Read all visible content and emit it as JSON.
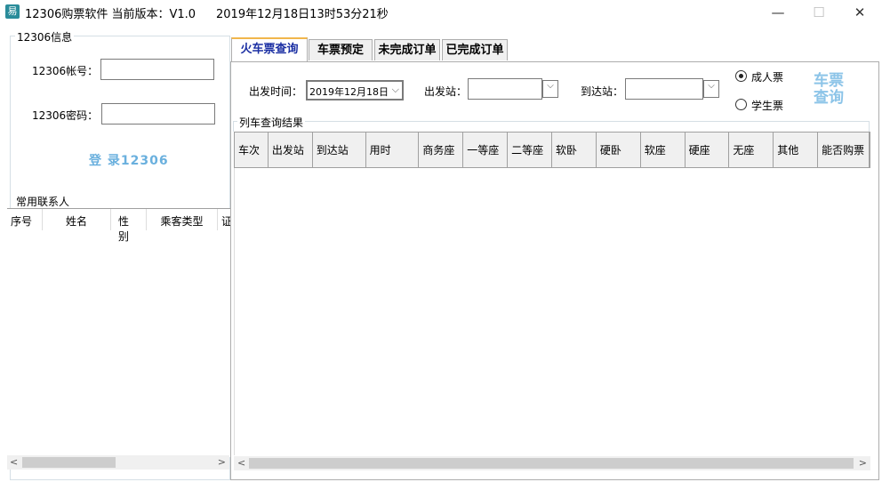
{
  "window": {
    "title": "12306购票软件 当前版本：V1.0",
    "datetime": "2019年12月18日13时53分21秒",
    "minimize": "—",
    "maximize": "☐",
    "close": "✕"
  },
  "login": {
    "group": "12306信息",
    "account_label": "12306帐号：",
    "account_value": "",
    "password_label": "12306密码：",
    "password_value": "",
    "login_button": "登 录12306"
  },
  "contacts": {
    "title": "常用联系人",
    "columns": [
      "序号",
      "姓名",
      "性别",
      "乘客类型",
      "证"
    ]
  },
  "tabs": [
    {
      "label": "火车票查询",
      "active": true
    },
    {
      "label": "车票预定"
    },
    {
      "label": "未完成订单"
    },
    {
      "label": "已完成订单"
    }
  ],
  "query": {
    "date_label": "出发时间：",
    "date_value": "2019年12月18日",
    "from_label": "出发站：",
    "from_value": "",
    "to_label": "到达站：",
    "to_value": "",
    "adult": "成人票",
    "student": "学生票",
    "ticket_type": "adult",
    "query_button": [
      "车票",
      "查询"
    ]
  },
  "results": {
    "title": "列车查询结果",
    "columns": [
      "车次",
      "出发站",
      "到达站",
      "用时",
      "商务座",
      "一等座",
      "二等座",
      "软卧",
      "硬卧",
      "软座",
      "硬座",
      "无座",
      "其他",
      "能否购票"
    ]
  },
  "colors": {
    "accent": "#1b2fa3",
    "link": "#6ab0de"
  }
}
